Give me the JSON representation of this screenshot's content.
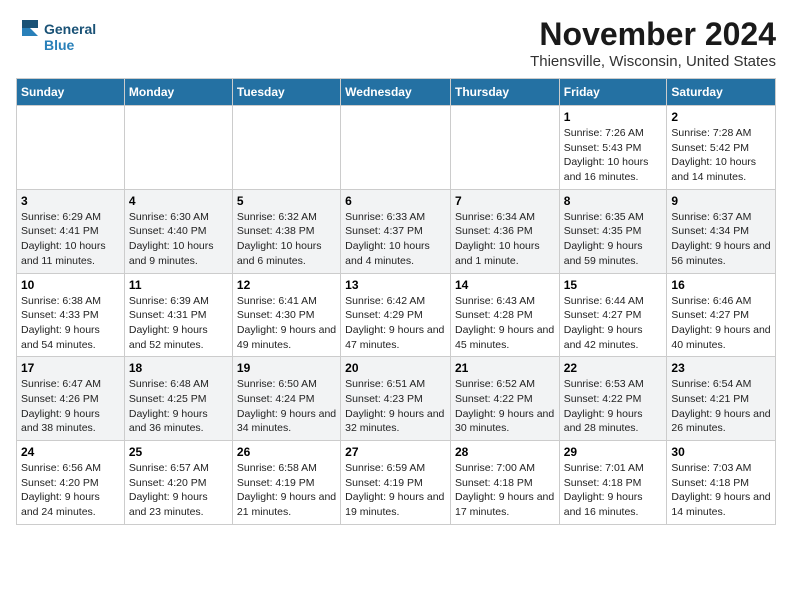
{
  "logo": {
    "line1": "General",
    "line2": "Blue"
  },
  "title": "November 2024",
  "location": "Thiensville, Wisconsin, United States",
  "days_of_week": [
    "Sunday",
    "Monday",
    "Tuesday",
    "Wednesday",
    "Thursday",
    "Friday",
    "Saturday"
  ],
  "weeks": [
    [
      {
        "day": "",
        "info": ""
      },
      {
        "day": "",
        "info": ""
      },
      {
        "day": "",
        "info": ""
      },
      {
        "day": "",
        "info": ""
      },
      {
        "day": "",
        "info": ""
      },
      {
        "day": "1",
        "info": "Sunrise: 7:26 AM\nSunset: 5:43 PM\nDaylight: 10 hours and 16 minutes."
      },
      {
        "day": "2",
        "info": "Sunrise: 7:28 AM\nSunset: 5:42 PM\nDaylight: 10 hours and 14 minutes."
      }
    ],
    [
      {
        "day": "3",
        "info": "Sunrise: 6:29 AM\nSunset: 4:41 PM\nDaylight: 10 hours and 11 minutes."
      },
      {
        "day": "4",
        "info": "Sunrise: 6:30 AM\nSunset: 4:40 PM\nDaylight: 10 hours and 9 minutes."
      },
      {
        "day": "5",
        "info": "Sunrise: 6:32 AM\nSunset: 4:38 PM\nDaylight: 10 hours and 6 minutes."
      },
      {
        "day": "6",
        "info": "Sunrise: 6:33 AM\nSunset: 4:37 PM\nDaylight: 10 hours and 4 minutes."
      },
      {
        "day": "7",
        "info": "Sunrise: 6:34 AM\nSunset: 4:36 PM\nDaylight: 10 hours and 1 minute."
      },
      {
        "day": "8",
        "info": "Sunrise: 6:35 AM\nSunset: 4:35 PM\nDaylight: 9 hours and 59 minutes."
      },
      {
        "day": "9",
        "info": "Sunrise: 6:37 AM\nSunset: 4:34 PM\nDaylight: 9 hours and 56 minutes."
      }
    ],
    [
      {
        "day": "10",
        "info": "Sunrise: 6:38 AM\nSunset: 4:33 PM\nDaylight: 9 hours and 54 minutes."
      },
      {
        "day": "11",
        "info": "Sunrise: 6:39 AM\nSunset: 4:31 PM\nDaylight: 9 hours and 52 minutes."
      },
      {
        "day": "12",
        "info": "Sunrise: 6:41 AM\nSunset: 4:30 PM\nDaylight: 9 hours and 49 minutes."
      },
      {
        "day": "13",
        "info": "Sunrise: 6:42 AM\nSunset: 4:29 PM\nDaylight: 9 hours and 47 minutes."
      },
      {
        "day": "14",
        "info": "Sunrise: 6:43 AM\nSunset: 4:28 PM\nDaylight: 9 hours and 45 minutes."
      },
      {
        "day": "15",
        "info": "Sunrise: 6:44 AM\nSunset: 4:27 PM\nDaylight: 9 hours and 42 minutes."
      },
      {
        "day": "16",
        "info": "Sunrise: 6:46 AM\nSunset: 4:27 PM\nDaylight: 9 hours and 40 minutes."
      }
    ],
    [
      {
        "day": "17",
        "info": "Sunrise: 6:47 AM\nSunset: 4:26 PM\nDaylight: 9 hours and 38 minutes."
      },
      {
        "day": "18",
        "info": "Sunrise: 6:48 AM\nSunset: 4:25 PM\nDaylight: 9 hours and 36 minutes."
      },
      {
        "day": "19",
        "info": "Sunrise: 6:50 AM\nSunset: 4:24 PM\nDaylight: 9 hours and 34 minutes."
      },
      {
        "day": "20",
        "info": "Sunrise: 6:51 AM\nSunset: 4:23 PM\nDaylight: 9 hours and 32 minutes."
      },
      {
        "day": "21",
        "info": "Sunrise: 6:52 AM\nSunset: 4:22 PM\nDaylight: 9 hours and 30 minutes."
      },
      {
        "day": "22",
        "info": "Sunrise: 6:53 AM\nSunset: 4:22 PM\nDaylight: 9 hours and 28 minutes."
      },
      {
        "day": "23",
        "info": "Sunrise: 6:54 AM\nSunset: 4:21 PM\nDaylight: 9 hours and 26 minutes."
      }
    ],
    [
      {
        "day": "24",
        "info": "Sunrise: 6:56 AM\nSunset: 4:20 PM\nDaylight: 9 hours and 24 minutes."
      },
      {
        "day": "25",
        "info": "Sunrise: 6:57 AM\nSunset: 4:20 PM\nDaylight: 9 hours and 23 minutes."
      },
      {
        "day": "26",
        "info": "Sunrise: 6:58 AM\nSunset: 4:19 PM\nDaylight: 9 hours and 21 minutes."
      },
      {
        "day": "27",
        "info": "Sunrise: 6:59 AM\nSunset: 4:19 PM\nDaylight: 9 hours and 19 minutes."
      },
      {
        "day": "28",
        "info": "Sunrise: 7:00 AM\nSunset: 4:18 PM\nDaylight: 9 hours and 17 minutes."
      },
      {
        "day": "29",
        "info": "Sunrise: 7:01 AM\nSunset: 4:18 PM\nDaylight: 9 hours and 16 minutes."
      },
      {
        "day": "30",
        "info": "Sunrise: 7:03 AM\nSunset: 4:18 PM\nDaylight: 9 hours and 14 minutes."
      }
    ]
  ]
}
